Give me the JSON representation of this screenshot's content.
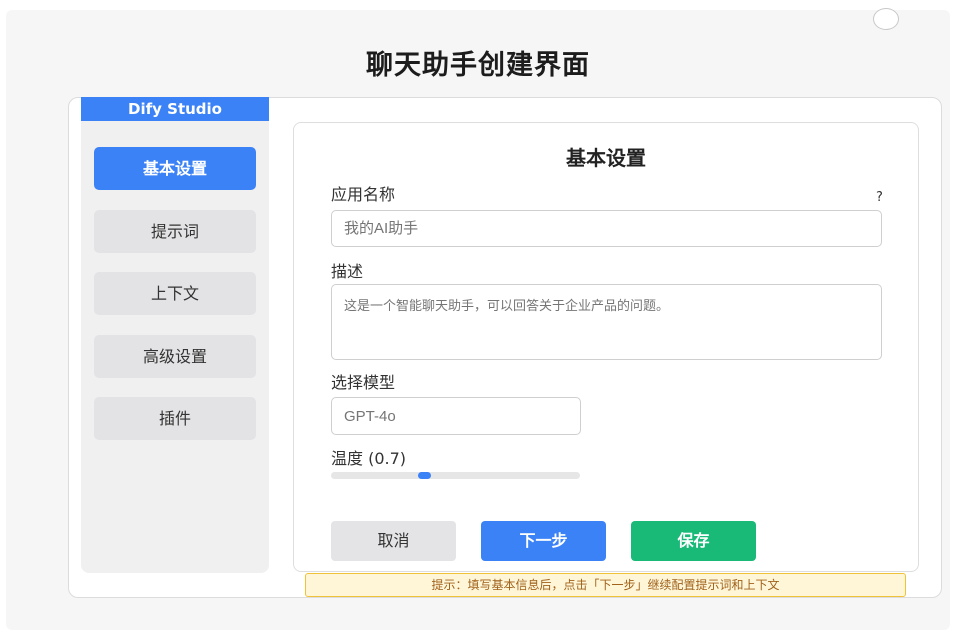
{
  "page": {
    "title": "聊天助手创建界面"
  },
  "sidebar": {
    "brand": "Dify Studio",
    "items": [
      {
        "label": "基本设置",
        "active": true
      },
      {
        "label": "提示词",
        "active": false
      },
      {
        "label": "上下文",
        "active": false
      },
      {
        "label": "高级设置",
        "active": false
      },
      {
        "label": "插件",
        "active": false
      }
    ]
  },
  "panel": {
    "title": "基本设置",
    "help": "?",
    "app_name": {
      "label": "应用名称",
      "placeholder": "我的AI助手"
    },
    "description": {
      "label": "描述",
      "placeholder": "这是一个智能聊天助手，可以回答关于企业产品的问题。"
    },
    "model": {
      "label": "选择模型",
      "placeholder": "GPT-4o"
    },
    "temperature": {
      "label": "温度 (0.7)",
      "value": 0.7
    }
  },
  "buttons": {
    "cancel": "取消",
    "next": "下一步",
    "save": "保存"
  },
  "tip": "提示：填写基本信息后，点击「下一步」继续配置提示词和上下文",
  "colors": {
    "accent": "#3b82f6",
    "save": "#19b978",
    "tip_bg": "#fff6d8",
    "tip_border": "#f0c23a"
  }
}
